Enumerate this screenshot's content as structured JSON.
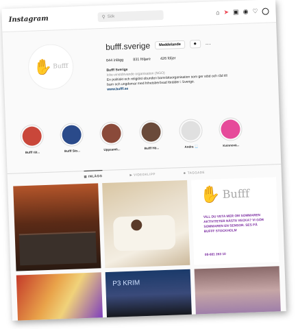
{
  "nav": {
    "logo": "Instagram",
    "search_placeholder": "Sök"
  },
  "profile": {
    "username": "bufff.sverige",
    "message_button": "Meddelande",
    "follow_icon": "person-icon",
    "more_label": "···",
    "stats": {
      "posts": "644 inlägg",
      "followers": "831 följare",
      "following": "426 följer"
    },
    "bio": {
      "name": "Bufff Sverige",
      "category": "Icke-vinstdrivande organisation (NGO)",
      "line1": "En politiskt och religiöst obunden barnrättsorganisation som ger stöd och råd till",
      "line2": "barn och ungdomar med frihetsberövad förälder i Sverige.",
      "link": "www.bufff.se"
    }
  },
  "highlights": [
    {
      "label": "Bufff rät...",
      "color": "#c9473a"
    },
    {
      "label": "Bufff Sto...",
      "color": "#2a4a8a"
    },
    {
      "label": "Uppsamli...",
      "color": "#8a4a3a"
    },
    {
      "label": "Bufff Hö...",
      "color": "#6a4a3a"
    },
    {
      "label": "Andra 📃",
      "color": "#e0e0e0"
    },
    {
      "label": "Kvinnovä...",
      "color": "#e64a9a"
    }
  ],
  "tabs": {
    "posts": "Inlägg",
    "reels": "Videoklipp",
    "tagged": "Taggade"
  },
  "posts": {
    "card_brand": "Bufff",
    "card_promo": "Vill du veta mer om sommaren aktiviteter nästa vecka? Vi gör sommaren en sensor. Ses på Bufff Stockholm",
    "card_phone": "08-681 263 10",
    "caption_p3": "P3 KRIM"
  }
}
